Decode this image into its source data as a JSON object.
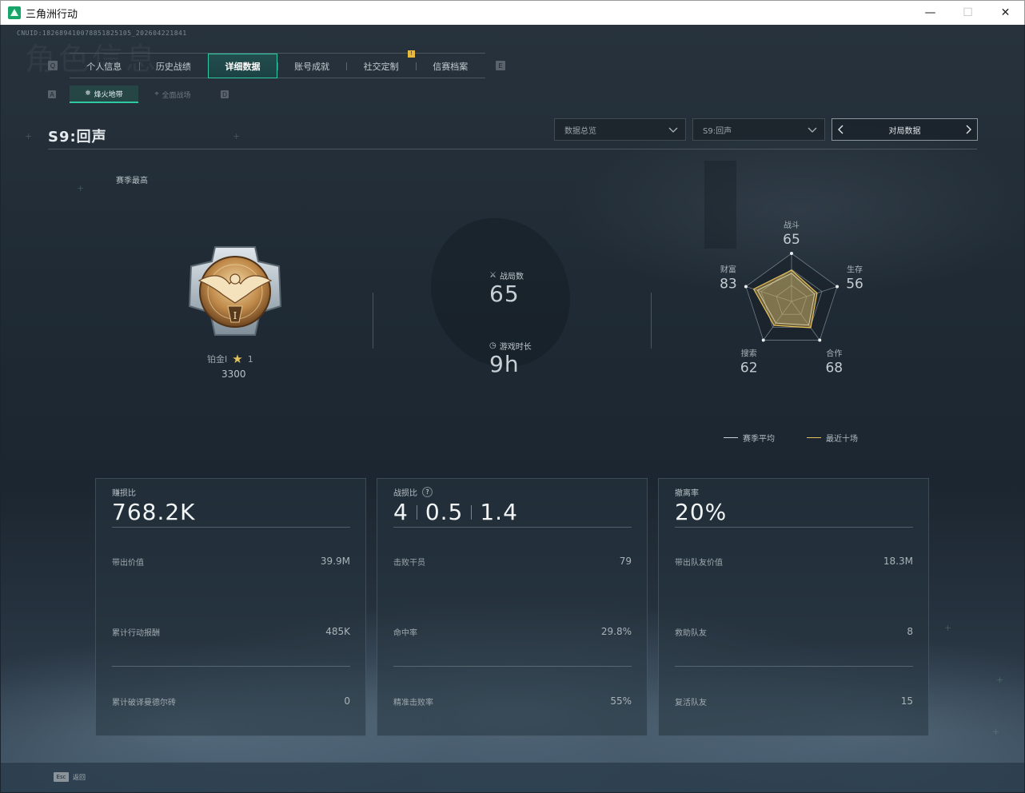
{
  "window": {
    "title": "三角洲行动",
    "minimize": "—",
    "maximize": "☐",
    "close": "✕"
  },
  "header": {
    "cnuid": "CNUID:182689410078851825105_202604221841",
    "bg_title": "角色信息"
  },
  "tabs": {
    "left_key": "Q",
    "right_key": "E",
    "items": [
      {
        "label": "个人信息"
      },
      {
        "label": "历史战绩"
      },
      {
        "label": "详细数据"
      },
      {
        "label": "账号成就"
      },
      {
        "label": "社交定制"
      },
      {
        "label": "信赛档案"
      }
    ],
    "badge": "!"
  },
  "subtabs": {
    "left_key": "A",
    "right_key": "D",
    "items": [
      {
        "label": "烽火地带"
      },
      {
        "label": "全面战场"
      }
    ]
  },
  "page": {
    "season_title": "S9:回声",
    "dropdown_overview": "数据总览",
    "dropdown_season": "S9:回声",
    "pager_label": "对局数据"
  },
  "rank": {
    "section_label": "赛季最高",
    "name": "铂金I",
    "stars": "1",
    "score": "3300",
    "medal_numeral": "I"
  },
  "summary": {
    "matches_label": "战局数",
    "matches_value": "65",
    "playtime_label": "游戏时长",
    "playtime_value": "9h"
  },
  "radar": {
    "axes": [
      {
        "label": "战斗",
        "value": "65"
      },
      {
        "label": "生存",
        "value": "56"
      },
      {
        "label": "合作",
        "value": "68"
      },
      {
        "label": "搜索",
        "value": "62"
      },
      {
        "label": "财富",
        "value": "83"
      }
    ],
    "legend_avg": "赛季平均",
    "legend_recent": "最近十场",
    "avg_color": "#c9d1d6",
    "recent_color": "#e6c05a"
  },
  "cards": [
    {
      "label": "赚损比",
      "big": "768.2K",
      "rows": [
        {
          "label": "带出价值",
          "value": "39.9M"
        },
        {
          "label": "累计行动报酬",
          "value": "485K"
        },
        {
          "label": "累计破译曼德尔砖",
          "value": "0"
        }
      ]
    },
    {
      "label": "战损比",
      "help": "?",
      "big_parts": [
        "4",
        "0.5",
        "1.4"
      ],
      "rows": [
        {
          "label": "击败干员",
          "value": "79"
        },
        {
          "label": "命中率",
          "value": "29.8%"
        },
        {
          "label": "精准击败率",
          "value": "55%"
        }
      ]
    },
    {
      "label": "撤离率",
      "big": "20%",
      "rows": [
        {
          "label": "带出队友价值",
          "value": "18.3M"
        },
        {
          "label": "救助队友",
          "value": "8"
        },
        {
          "label": "复活队友",
          "value": "15"
        }
      ]
    }
  ],
  "footer": {
    "esc_key": "Esc",
    "esc_label": "返回"
  }
}
